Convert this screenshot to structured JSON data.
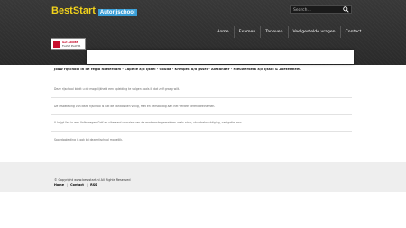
{
  "header": {
    "logo_main": "BestStart",
    "logo_sub": "Autorijschool"
  },
  "search": {
    "placeholder": "Search..."
  },
  "nav": [
    "Home",
    "Examen",
    "Tarieven",
    "Veelgestelde vragen",
    "Contact"
  ],
  "flash_badge": {
    "line1": "Get ADOBE",
    "line2": "FLASH PLAYER"
  },
  "intro": "Jouw rijschool in de regio Rotterdam - Capelle a/d IJssel - Gouda - Krimpen a/d IJssel - Alexander - Nieuwerkerk a/d IJssel & Zoetermeer.",
  "paragraphs": [
    "Deze rijschool biedt u de mogelijkheid een opleiding te volgen zoals ik dat zelf graag wilt.",
    "De lesbeleving van deze rijschool is dat de kandidaten veilig, met en zelfstandig aan het verkeer leren deelnemen.",
    "U krijgt lles in een Volkswagen Golf en uiteraard voorzien van de modernste gemakken zoals airco, stuurbekrachtiging, navigatie, enz.",
    "Spoedopleiding is ook bij deze rijschool mogelijk."
  ],
  "footer": {
    "copyright": "© Copyright www.beststart.nl All Rights Reserved",
    "links": [
      "Home",
      "Contact",
      "RSS"
    ]
  },
  "colors": {
    "brand_yellow": "#f2d21b",
    "brand_blue": "#3a9fd8",
    "header_bg": "#2f2f2f"
  }
}
